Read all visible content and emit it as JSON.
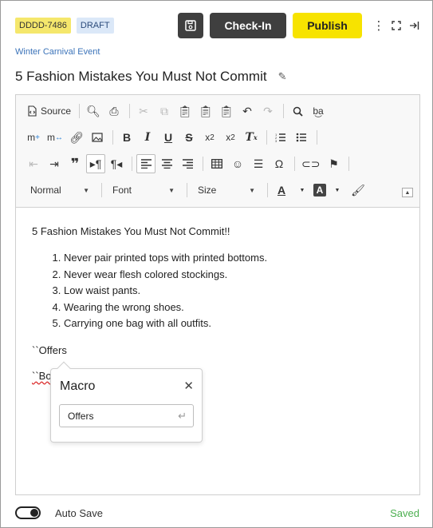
{
  "header": {
    "id_badge": "DDDD-7486",
    "status_badge": "DRAFT",
    "checkin_label": "Check-In",
    "publish_label": "Publish"
  },
  "breadcrumb": "Winter Carnival Event",
  "title": "5 Fashion Mistakes You Must Not Commit",
  "toolbar": {
    "source_label": "Source",
    "format_combo": "Normal",
    "font_combo": "Font",
    "size_combo": "Size"
  },
  "content": {
    "heading": "5 Fashion Mistakes You Must Not Commit!!",
    "items": [
      "Never pair printed tops with printed bottoms.",
      "Never wear flesh colored stockings.",
      "Low waist pants.",
      "Wearing the wrong shoes.",
      "Carrying one bag with all outfits."
    ],
    "macro_line_1": "``Offers",
    "macro_line_2_prefix": "``Bo"
  },
  "macro_popup": {
    "title": "Macro",
    "input_value": "Offers"
  },
  "footer": {
    "autosave_label": "Auto Save",
    "autosave_on": true,
    "saved_label": "Saved"
  },
  "colors": {
    "id_badge_bg": "#f5e76c",
    "status_badge_bg": "#dbe8f8",
    "publish_bg": "#f7e300",
    "dark_button": "#3f3f3f",
    "saved_green": "#4caf50",
    "link_blue": "#3b73b9"
  }
}
